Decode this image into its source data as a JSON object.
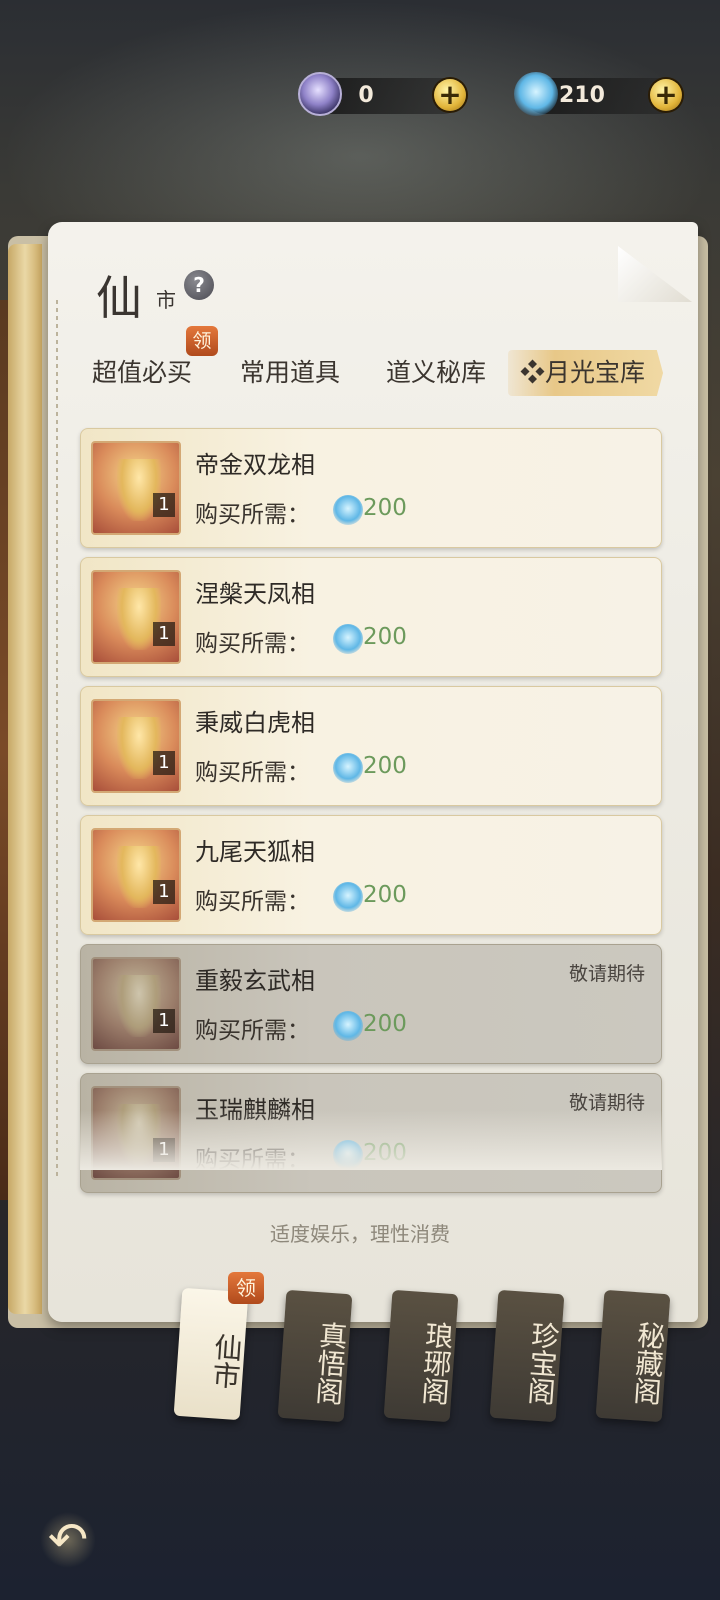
{
  "currencies": [
    {
      "icon": "jade-coin-icon",
      "value": "0"
    },
    {
      "icon": "spirit-wave-icon",
      "value": "210"
    }
  ],
  "header": {
    "title_big": "仙",
    "title_small": "市",
    "help": "?"
  },
  "tabs": [
    {
      "label": "超值必买",
      "badge": "领"
    },
    {
      "label": "常用道具"
    },
    {
      "label": "道义秘库"
    },
    {
      "label": "月光宝库",
      "active": true
    }
  ],
  "price_label": "购买所需：",
  "items": [
    {
      "name": "帝金双龙相",
      "qty": "1",
      "price": "200",
      "soon": ""
    },
    {
      "name": "涅槃天凤相",
      "qty": "1",
      "price": "200",
      "soon": ""
    },
    {
      "name": "秉威白虎相",
      "qty": "1",
      "price": "200",
      "soon": ""
    },
    {
      "name": "九尾天狐相",
      "qty": "1",
      "price": "200",
      "soon": ""
    },
    {
      "name": "重毅玄武相",
      "qty": "1",
      "price": "200",
      "soon": "敬请期待"
    },
    {
      "name": "玉瑞麒麟相",
      "qty": "1",
      "price": "200",
      "soon": "敬请期待"
    }
  ],
  "notice": "适度娱乐，理性消费",
  "bottom_nav": [
    {
      "label": "仙市",
      "badge": "领",
      "active": true
    },
    {
      "label": "真悟阁"
    },
    {
      "label": "琅琊阁"
    },
    {
      "label": "珍宝阁"
    },
    {
      "label": "秘藏阁"
    }
  ],
  "icons": {
    "plus": "+",
    "back": "↶",
    "diamond": "❖"
  }
}
